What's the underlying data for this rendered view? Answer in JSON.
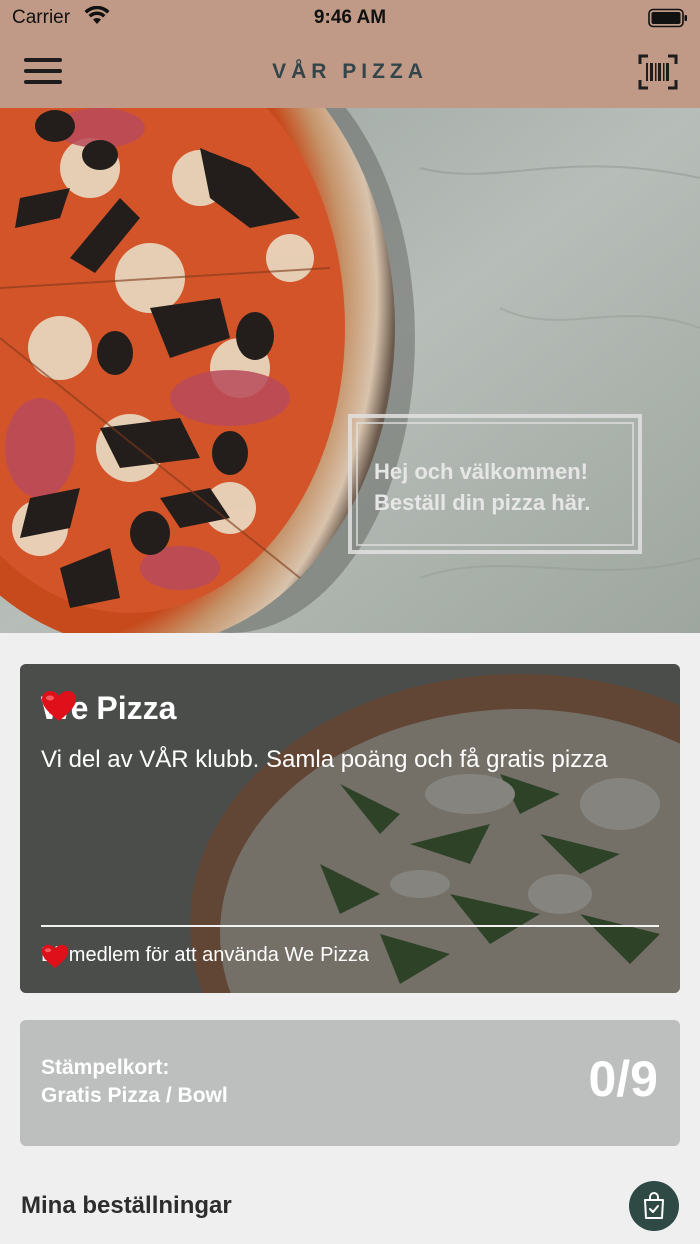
{
  "status_bar": {
    "carrier": "Carrier",
    "time": "9:46 AM"
  },
  "nav": {
    "brand": "VÅR PIZZA",
    "menu_icon": "hamburger-menu-icon",
    "scan_icon": "barcode-scan-icon"
  },
  "hero": {
    "line1": "Hej och välkommen!",
    "line2": "Beställ din pizza här."
  },
  "club": {
    "title_before": "We",
    "title_after": "Pizza",
    "subtitle": "Vi del av VÅR klubb.  Samla poäng och få gratis pizza",
    "footer_before": "Bli medlem för att använda We",
    "footer_after": "Pizza",
    "heart_icon": "heart-icon"
  },
  "stamp_card": {
    "label_line1": "Stämpelkort:",
    "label_line2": "Gratis Pizza / Bowl",
    "count": "0/9"
  },
  "orders": {
    "title": "Mina beställningar",
    "icon": "shopping-bag-check-icon"
  },
  "colors": {
    "header": "#c09a87",
    "accent_dark": "#2f4a45",
    "stamp_card": "#bdbfbf",
    "background": "#efefef"
  }
}
